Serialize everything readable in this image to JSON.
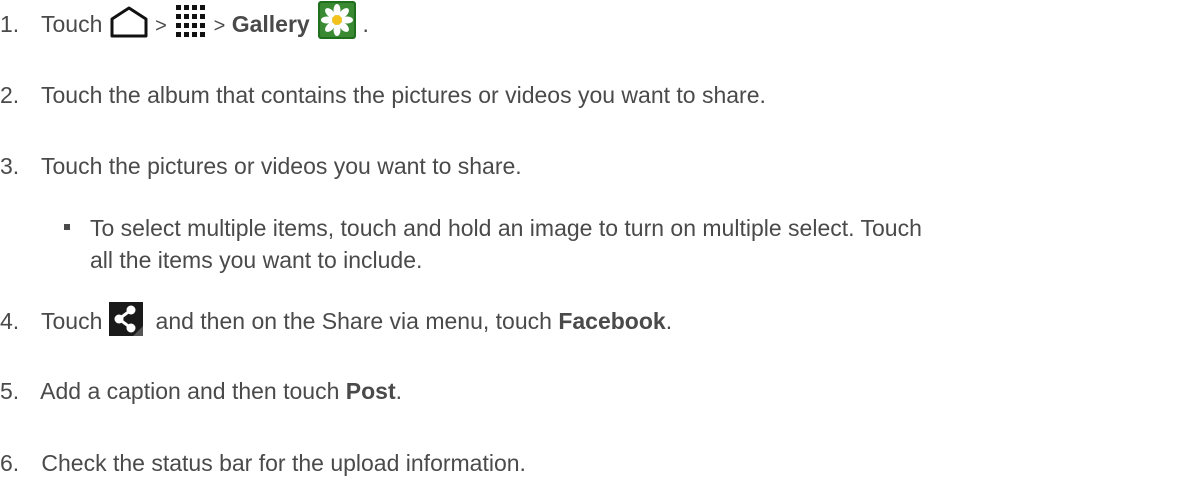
{
  "steps": [
    {
      "num": "1.",
      "touch": "Touch",
      "sep1": ">",
      "sep2": ">",
      "gallery": "Gallery",
      "end": ".",
      "icons": [
        "home-icon",
        "apps-icon",
        "gallery-icon"
      ]
    },
    {
      "num": "2.",
      "text": "Touch the album that contains the pictures or videos you want to share."
    },
    {
      "num": "3.",
      "text": "Touch the pictures or videos you want to share."
    },
    {
      "num": "4.",
      "touch": "Touch",
      "after_icon": " and then on the Share via menu, touch ",
      "bold": "Facebook",
      "end": ".",
      "icon": "share-icon"
    },
    {
      "num": "5.",
      "before": "Add a caption and then touch ",
      "bold": "Post",
      "end": "."
    },
    {
      "num": "6.",
      "text": "Check the status bar for the upload information."
    }
  ],
  "subitem": {
    "line1": "To select multiple items, touch and hold an image to turn on multiple select. Touch",
    "line2": "all the items you want to include."
  },
  "colors": {
    "text": "#4a4a4a",
    "gallery_bg": "#1f6f1f",
    "share_bg": "#1a1a1a"
  }
}
